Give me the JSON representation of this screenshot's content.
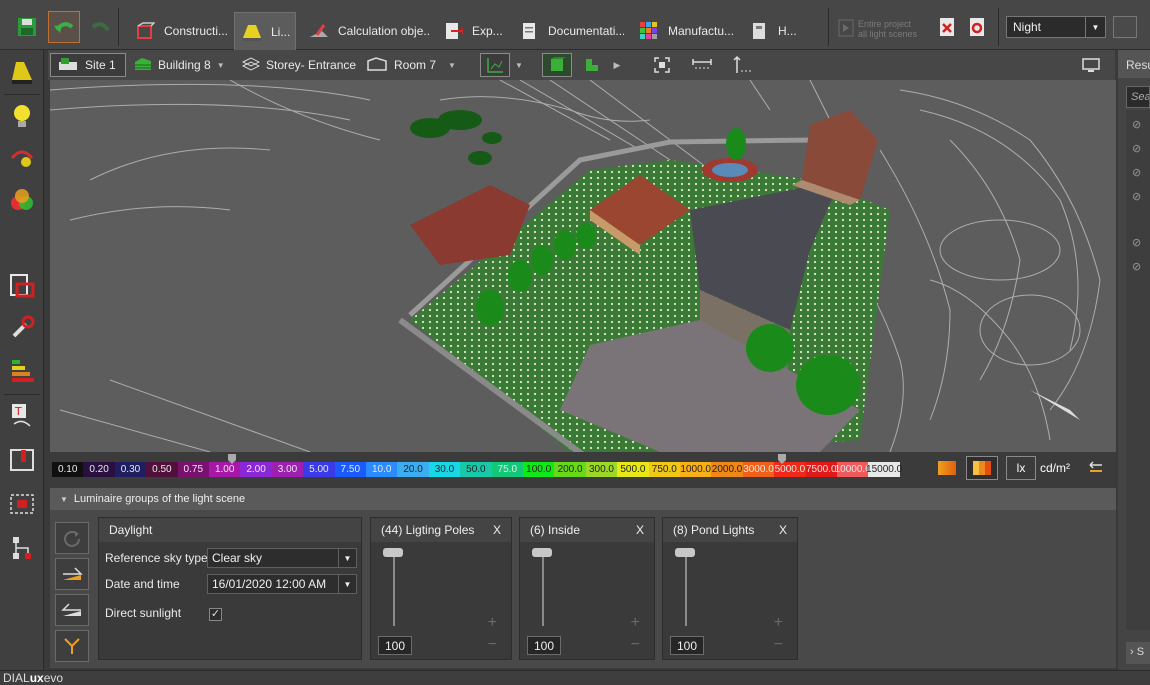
{
  "app": {
    "status_brand_a": "DIAL",
    "status_brand_b": "ux",
    "status_brand_c": "evo"
  },
  "ribbon": {
    "tabs": [
      {
        "label": "Constructi..."
      },
      {
        "label": "Li..."
      },
      {
        "label": "Calculation obje..."
      },
      {
        "label": "Exp..."
      },
      {
        "label": "Documentati..."
      },
      {
        "label": "Manufactu..."
      },
      {
        "label": "H..."
      }
    ],
    "entire_line1": "Entire project",
    "entire_line2": "all light scenes",
    "scene_select": "Night"
  },
  "breadcrumb": {
    "site": "Site 1",
    "building": "Building 8",
    "storey": "Storey- Entrance",
    "room": "Room 7"
  },
  "scale": {
    "values": [
      "0.10",
      "0.20",
      "0.30",
      "0.50",
      "0.75",
      "1.00",
      "2.00",
      "3.00",
      "5.00",
      "7.50",
      "10.0",
      "20.0",
      "30.0",
      "50.0",
      "75.0",
      "100.0",
      "200.0",
      "300.0",
      "500.0",
      "750.0",
      "1000.0",
      "2000.0",
      "3000.0",
      "5000.0",
      "7500.0",
      "10000.0",
      "15000.0"
    ],
    "colors": [
      "#101010",
      "#2a1040",
      "#1e1e60",
      "#50103a",
      "#7a1070",
      "#a818a8",
      "#8a28d8",
      "#9c1fb0",
      "#3a3ae8",
      "#1a5aff",
      "#2a8cff",
      "#3aaef0",
      "#18d8e8",
      "#18c8a8",
      "#10c878",
      "#10e818",
      "#6ad81a",
      "#9cd828",
      "#e8e818",
      "#f0c818",
      "#f8b018",
      "#f08818",
      "#f06018",
      "#f02818",
      "#e01818",
      "#f05a5a",
      "#e8e8e8"
    ],
    "unit_lx": "lx",
    "unit_cd": "cd/m²"
  },
  "panel": {
    "title": "Luminaire groups of the light scene",
    "daylight": {
      "title": "Daylight",
      "sky_label": "Reference sky type",
      "sky_value": "Clear sky",
      "date_label": "Date and time",
      "date_value": "16/01/2020 12:00 AM",
      "sun_label": "Direct sunlight",
      "sun_checked": "✓"
    },
    "groups": [
      {
        "name": "(44)  Ligting Poles",
        "close": "X",
        "value": "100"
      },
      {
        "name": "(6)  Inside",
        "close": "X",
        "value": "100"
      },
      {
        "name": "(8)  Pond Lights",
        "close": "X",
        "value": "100"
      }
    ]
  },
  "results": {
    "title": "Resu",
    "search_placeholder": "Sea",
    "footer": "S"
  }
}
